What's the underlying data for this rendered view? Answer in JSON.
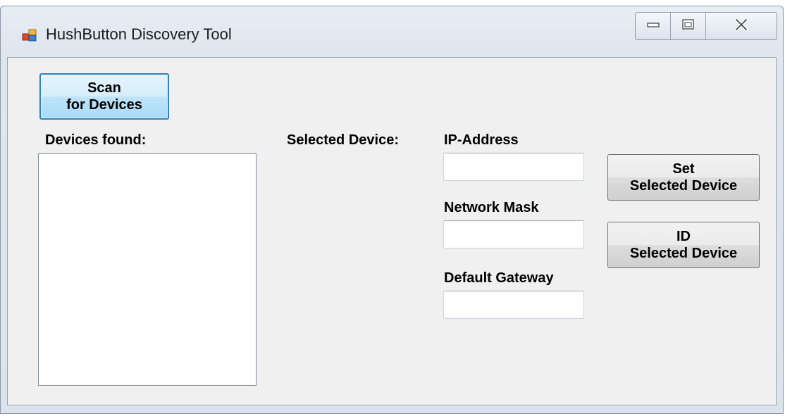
{
  "window": {
    "title": "HushButton Discovery Tool",
    "icons": {
      "app": "app-icon",
      "minimize": "minimize-icon",
      "maximize": "maximize-icon",
      "close": "close-icon"
    }
  },
  "buttons": {
    "scan": {
      "line1": "Scan",
      "line2": "for Devices"
    },
    "set": {
      "line1": "Set",
      "line2": "Selected Device"
    },
    "id": {
      "line1": "ID",
      "line2": "Selected Device"
    }
  },
  "labels": {
    "devices_found": "Devices found:",
    "selected_device": "Selected Device:",
    "ip_address": "IP-Address",
    "network_mask": "Network Mask",
    "default_gateway": "Default Gateway"
  },
  "fields": {
    "ip_address": {
      "value": ""
    },
    "network_mask": {
      "value": ""
    },
    "default_gateway": {
      "value": ""
    }
  },
  "devices_list": []
}
